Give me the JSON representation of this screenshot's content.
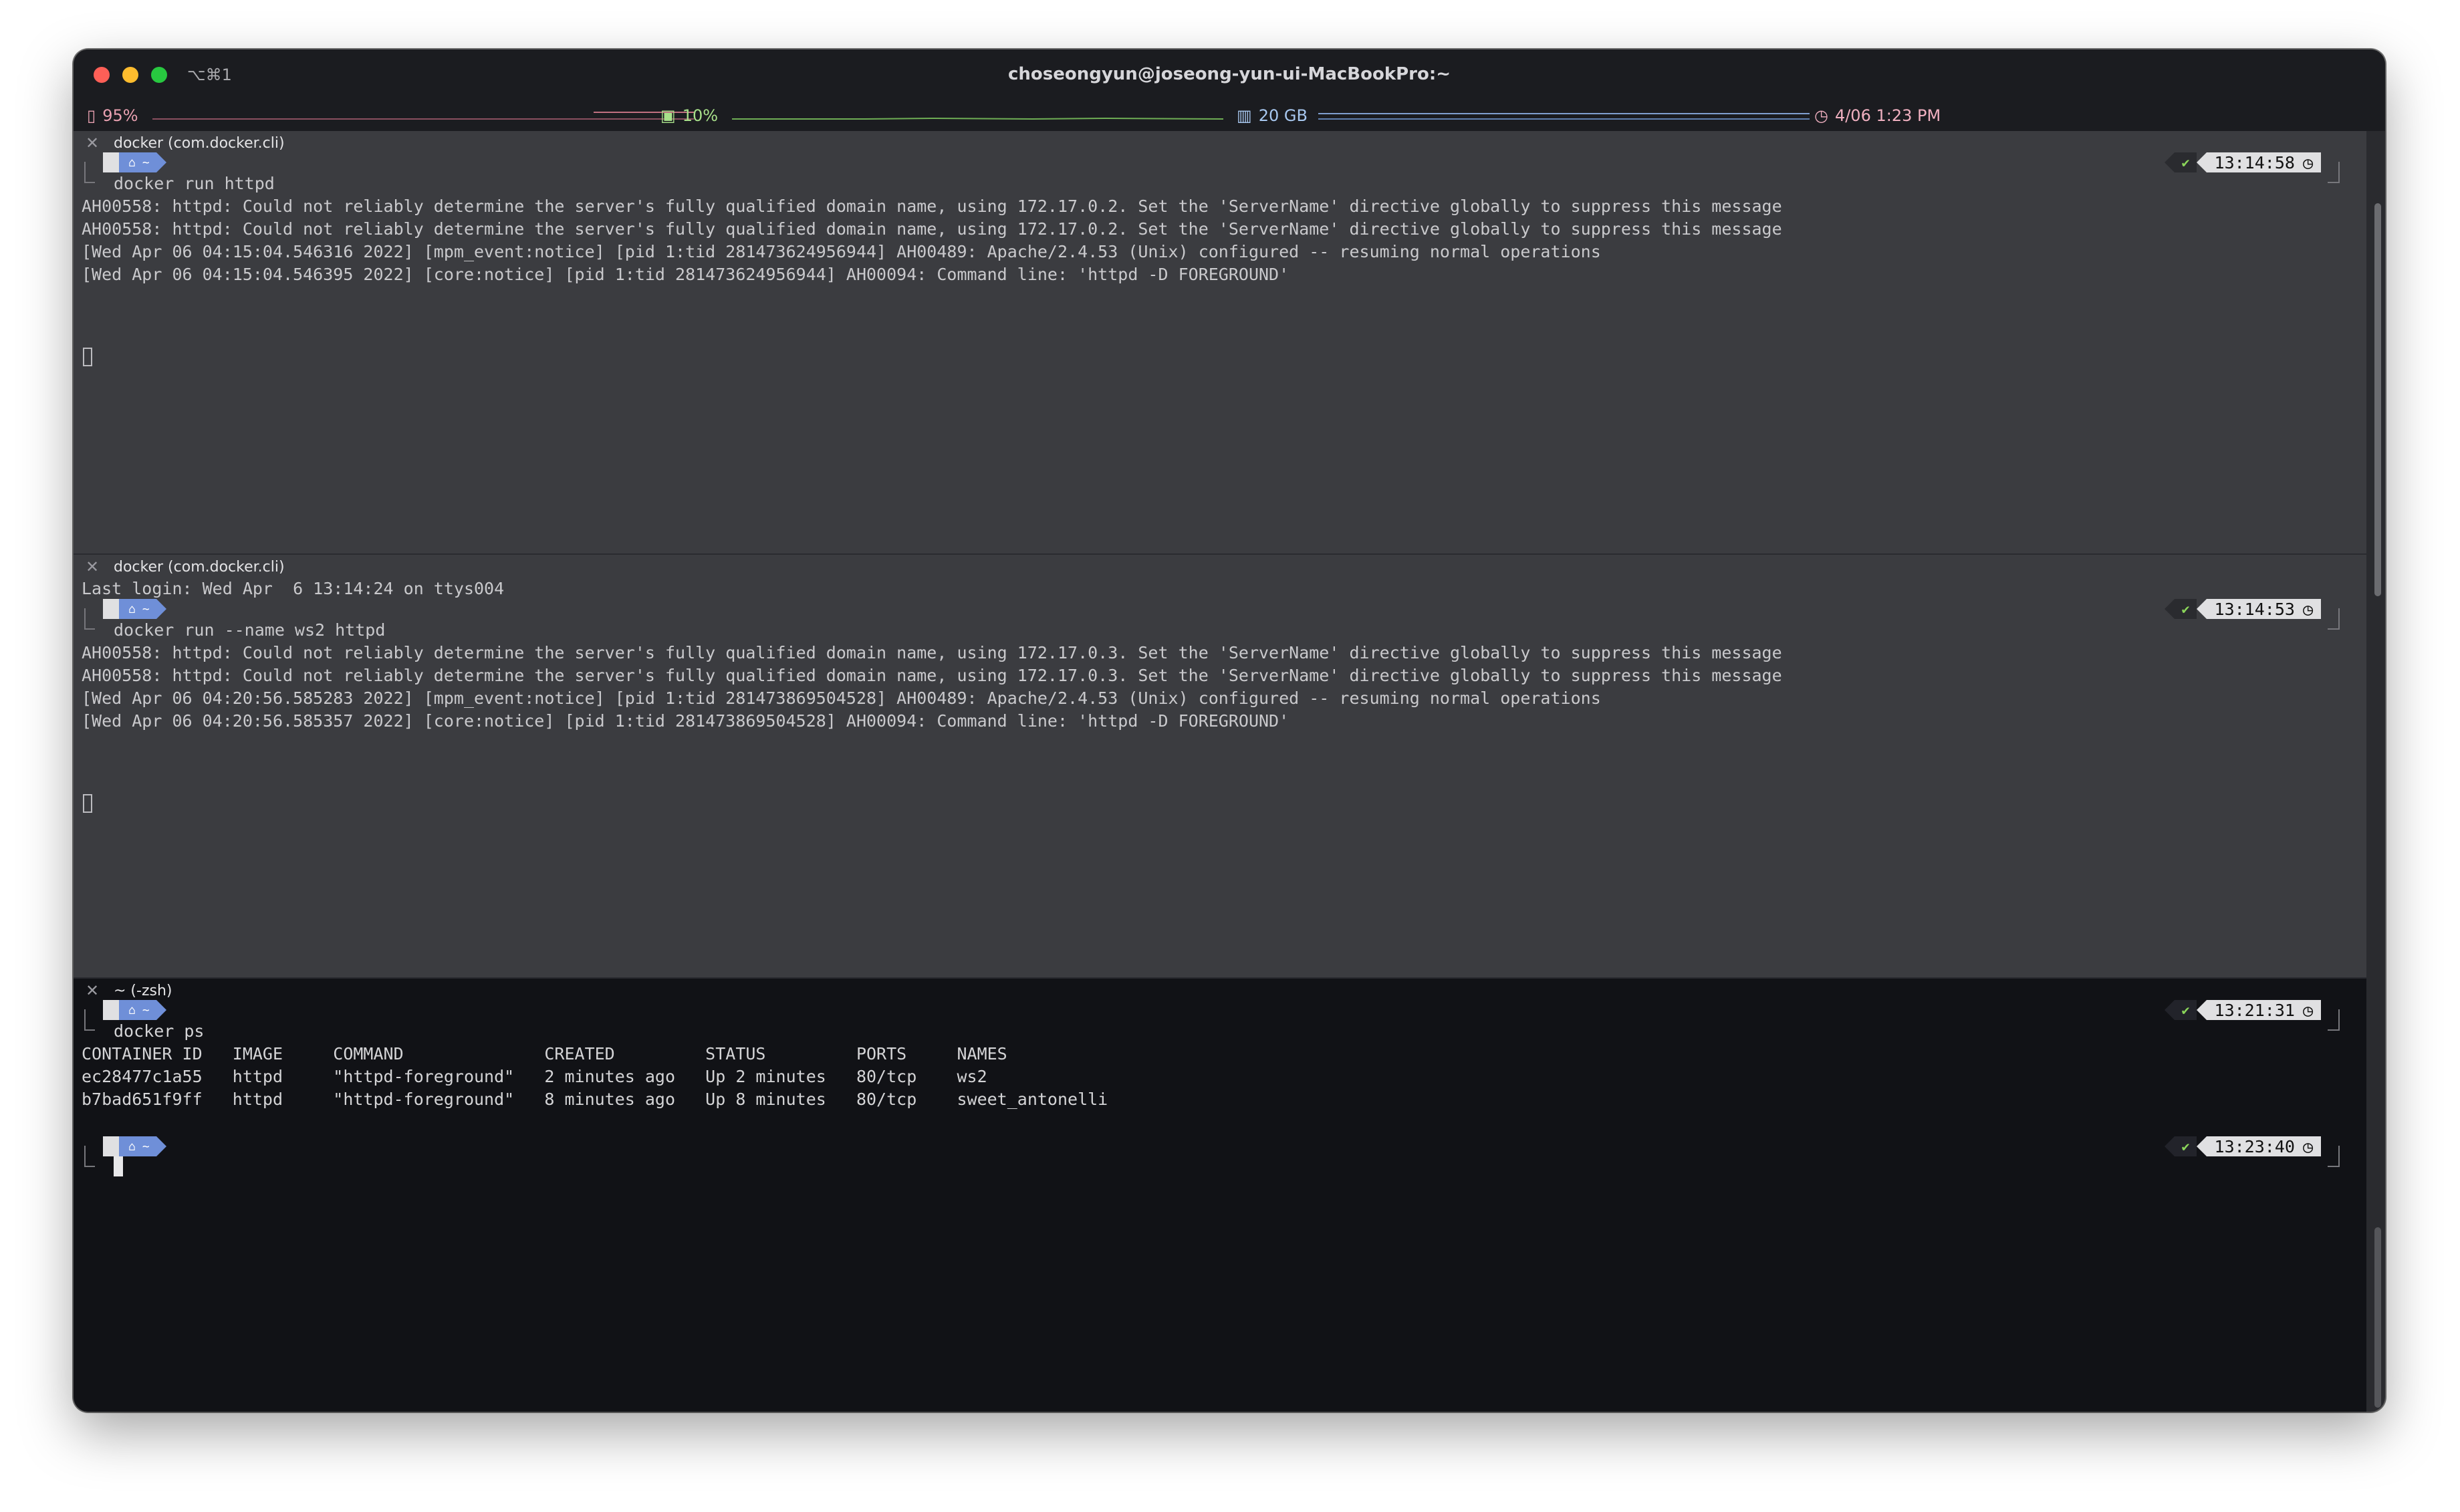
{
  "window": {
    "title": "choseongyun@joseong-yun-ui-MacBookPro:~",
    "shortcut": "⌥⌘1"
  },
  "statusbar": {
    "battery": "95%",
    "cpu": "10%",
    "memory": "20 GB",
    "datetime": "4/06 1:23 PM"
  },
  "panes": [
    {
      "title": "docker (com.docker.cli)",
      "prompt_time": "13:14:58",
      "command": "docker run httpd",
      "output": [
        "AH00558: httpd: Could not reliably determine the server's fully qualified domain name, using 172.17.0.2. Set the 'ServerName' directive globally to suppress this message",
        "AH00558: httpd: Could not reliably determine the server's fully qualified domain name, using 172.17.0.2. Set the 'ServerName' directive globally to suppress this message",
        "[Wed Apr 06 04:15:04.546316 2022] [mpm_event:notice] [pid 1:tid 281473624956944] AH00489: Apache/2.4.53 (Unix) configured -- resuming normal operations",
        "[Wed Apr 06 04:15:04.546395 2022] [core:notice] [pid 1:tid 281473624956944] AH00094: Command line: 'httpd -D FOREGROUND'"
      ]
    },
    {
      "title": "docker (com.docker.cli)",
      "last_login": "Last login: Wed Apr  6 13:14:24 on ttys004",
      "prompt_time": "13:14:53",
      "command": "docker run --name ws2 httpd",
      "output": [
        "AH00558: httpd: Could not reliably determine the server's fully qualified domain name, using 172.17.0.3. Set the 'ServerName' directive globally to suppress this message",
        "AH00558: httpd: Could not reliably determine the server's fully qualified domain name, using 172.17.0.3. Set the 'ServerName' directive globally to suppress this message",
        "[Wed Apr 06 04:20:56.585283 2022] [mpm_event:notice] [pid 1:tid 281473869504528] AH00489: Apache/2.4.53 (Unix) configured -- resuming normal operations",
        "[Wed Apr 06 04:20:56.585357 2022] [core:notice] [pid 1:tid 281473869504528] AH00094: Command line: 'httpd -D FOREGROUND'"
      ]
    },
    {
      "title": "~ (-zsh)",
      "prompt_time": "13:21:31",
      "command": "docker ps",
      "output": [
        "CONTAINER ID   IMAGE     COMMAND              CREATED         STATUS         PORTS     NAMES",
        "ec28477c1a55   httpd     \"httpd-foreground\"   2 minutes ago   Up 2 minutes   80/tcp    ws2",
        "b7bad651f9ff   httpd     \"httpd-foreground\"   8 minutes ago   Up 8 minutes   80/tcp    sweet_antonelli"
      ],
      "prompt_time_2": "13:23:40"
    }
  ],
  "prompt": {
    "apple_glyph": "",
    "home_glyph": "⌂",
    "dir": "~",
    "check": "✔",
    "clock_glyph": "◷"
  },
  "icons": {
    "close": "✕",
    "more": "···",
    "battery_icon": "▯",
    "cpu_icon": "▣",
    "memory_icon": "▥",
    "clock_icon": "◷"
  },
  "colors": {
    "pane_bg": "#3b3c40",
    "active_pane_bg": "#111216",
    "prompt_home": "#6f8fd8",
    "check": "#8bd65a",
    "battery": "#e8a0b0",
    "cpu": "#a8e08a",
    "memory": "#a8c8f0",
    "datetime": "#f0b0c0"
  }
}
